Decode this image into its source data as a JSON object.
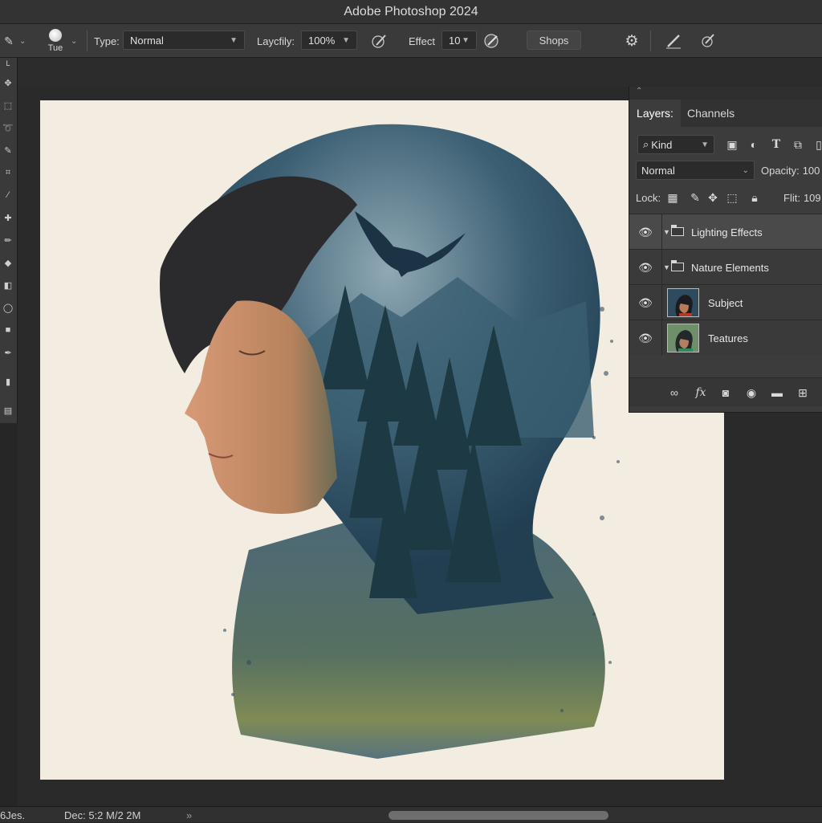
{
  "window": {
    "title": "Adobe Photoshop 2024"
  },
  "options_bar": {
    "brush_label": "Tue",
    "type_label": "Type:",
    "type_value": "Normal",
    "opacity_label": "Laycfily:",
    "opacity_value": "100%",
    "effect_label": "Effect",
    "effect_value": "10",
    "shops_button": "Shops"
  },
  "toolbar": {
    "top_label": "L"
  },
  "layers_panel": {
    "tabs": [
      "Layers:",
      "Channels"
    ],
    "filter_kind": "Kind",
    "blend_mode": "Normal",
    "opacity_label": "Opacity:",
    "opacity_value": "100",
    "lock_label": "Lock:",
    "fill_label": "Flit:",
    "fill_value": "109",
    "layers": [
      {
        "name": "Lighting Effects",
        "type": "group",
        "visible": true
      },
      {
        "name": "Nature Elements",
        "type": "group",
        "visible": true
      },
      {
        "name": "Subject",
        "type": "layer",
        "visible": true
      },
      {
        "name": "Teatures",
        "type": "layer",
        "visible": true
      }
    ]
  },
  "status_bar": {
    "left_text": "6Jes.",
    "doc_info": "Dec: 5:2 M/2 2M",
    "arrow": "»"
  },
  "colors": {
    "canvas_bg": "#f3ece0",
    "artwork_blue": "#2e4d64",
    "forest_dark": "#1f3a40",
    "skin": "#c98a66"
  }
}
